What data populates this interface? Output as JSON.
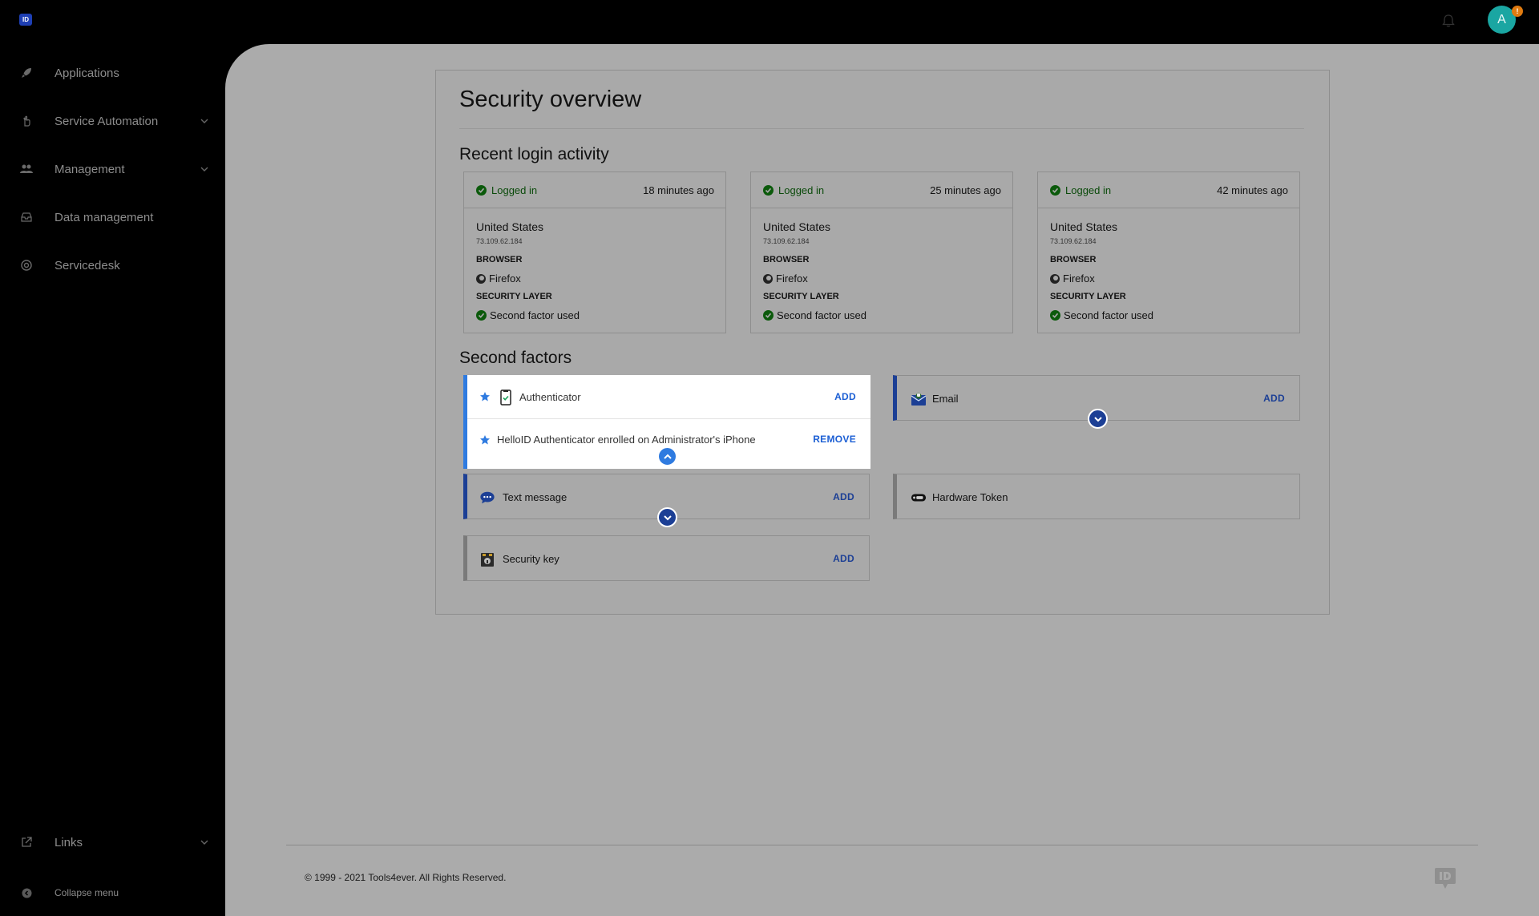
{
  "topbar": {
    "logo_text": "ID",
    "avatar_initial": "A",
    "avatar_badge": "!"
  },
  "sidebar": {
    "items": [
      {
        "label": "Applications",
        "icon": "rocket-icon"
      },
      {
        "label": "Service Automation",
        "icon": "hand-icon",
        "expandable": true
      },
      {
        "label": "Management",
        "icon": "users-icon",
        "expandable": true
      },
      {
        "label": "Data management",
        "icon": "inbox-icon"
      },
      {
        "label": "Servicedesk",
        "icon": "lifebuoy-icon"
      }
    ],
    "links_label": "Links",
    "collapse_label": "Collapse menu"
  },
  "page": {
    "title": "Security overview",
    "recent_title": "Recent login activity",
    "factors_title": "Second factors"
  },
  "logins": [
    {
      "status": "Logged in",
      "when": "18 minutes ago",
      "country": "United States",
      "ip": "73.109.62.184",
      "browser_label": "BROWSER",
      "browser": "Firefox",
      "security_label": "SECURITY LAYER",
      "security": "Second factor used"
    },
    {
      "status": "Logged in",
      "when": "25 minutes ago",
      "country": "United States",
      "ip": "73.109.62.184",
      "browser_label": "BROWSER",
      "browser": "Firefox",
      "security_label": "SECURITY LAYER",
      "security": "Second factor used"
    },
    {
      "status": "Logged in",
      "when": "42 minutes ago",
      "country": "United States",
      "ip": "73.109.62.184",
      "browser_label": "BROWSER",
      "browser": "Firefox",
      "security_label": "SECURITY LAYER",
      "security": "Second factor used"
    }
  ],
  "factors": {
    "authenticator": {
      "label": "Authenticator",
      "action": "ADD",
      "enrolled": "HelloID Authenticator enrolled on Administrator's iPhone",
      "remove": "REMOVE"
    },
    "email": {
      "label": "Email",
      "action": "ADD"
    },
    "text_message": {
      "label": "Text message",
      "action": "ADD"
    },
    "hardware_token": {
      "label": "Hardware Token"
    },
    "security_key": {
      "label": "Security key",
      "action": "ADD"
    }
  },
  "footer": {
    "copyright": "© 1999 - 2021 Tools4ever. All Rights Reserved."
  },
  "colors": {
    "accent": "#1c3f95",
    "active_accent": "#2f7be0",
    "success": "#0b5a0b",
    "avatar": "#1aa6a2"
  }
}
